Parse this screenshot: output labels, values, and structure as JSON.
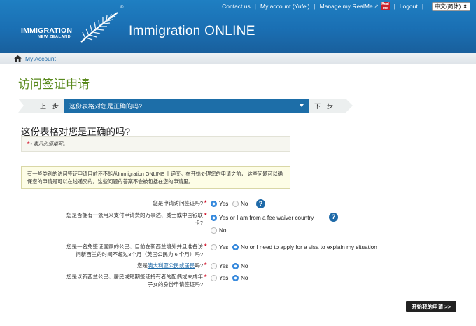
{
  "topnav": {
    "contact": "Contact us",
    "account": "My account (Yufei)",
    "realme": "Manage my RealMe",
    "realme_badge": "Real me",
    "logout": "Logout",
    "language": "中文(简体)"
  },
  "logo": {
    "line1": "IMMIGRATION",
    "line2": "NEW ZEALAND",
    "registered": "®"
  },
  "site_title": "Immigration ONLINE",
  "breadcrumb": {
    "home": "My Account"
  },
  "page_title": "访问签证申请",
  "steps": {
    "prev": "上一步",
    "current": "这份表格对您是正确的吗?",
    "next": "下一步"
  },
  "question_heading": "这份表格对您是正确的吗?",
  "required_note": {
    "star": "*",
    "text": "- 表示必须填写。"
  },
  "info_note": "有一些类别的访问签证申请目前还不能从Immigration ONLINE 上递交。在开始处理您的申请之前， 这些问题可以确保您的申请是可以在线递交的。这些问题的答案不会被包括在您的申请里。",
  "questions": {
    "q1": {
      "label": "您是申请访问签证吗?",
      "star": "*",
      "opt_yes": "Yes",
      "opt_no": "No"
    },
    "q2": {
      "label_line1": "您是否拥有一张用来支付申请费的万事达、威士或中国银联",
      "label_line2": "卡?",
      "star": "*",
      "opt_yes": "Yes or I am from a fee waiver country",
      "opt_no": "No"
    },
    "q3": {
      "label_line1": "您是一名免签证国家的公民、目前在新西兰境外并且准备访",
      "label_line2": "问新西兰的时间不超过3个月（英国公民为 6 个月）吗?",
      "star": "*",
      "opt_yes": "Yes",
      "opt_no": "No or I need to apply for a visa to explain my situation"
    },
    "q4": {
      "label_pre": "您是",
      "label_link": "澳大利亚公民或居民",
      "label_post": "吗?",
      "star": "*",
      "opt_yes": "Yes",
      "opt_no": "No"
    },
    "q5": {
      "label_line1": "您是以新西兰公民、居民或短期签证持有者的配偶或未成年",
      "label_line2": "子女的身份申请签证吗?",
      "star": "*",
      "opt_yes": "Yes",
      "opt_no": "No"
    }
  },
  "help_glyph": "?",
  "start_button": "开始我的申请 >>",
  "colors": {
    "header_blue": "#1a6fb3",
    "title_green": "#5a8a1e",
    "step_blue": "#1d6ea8",
    "required_red": "#d0021b"
  }
}
